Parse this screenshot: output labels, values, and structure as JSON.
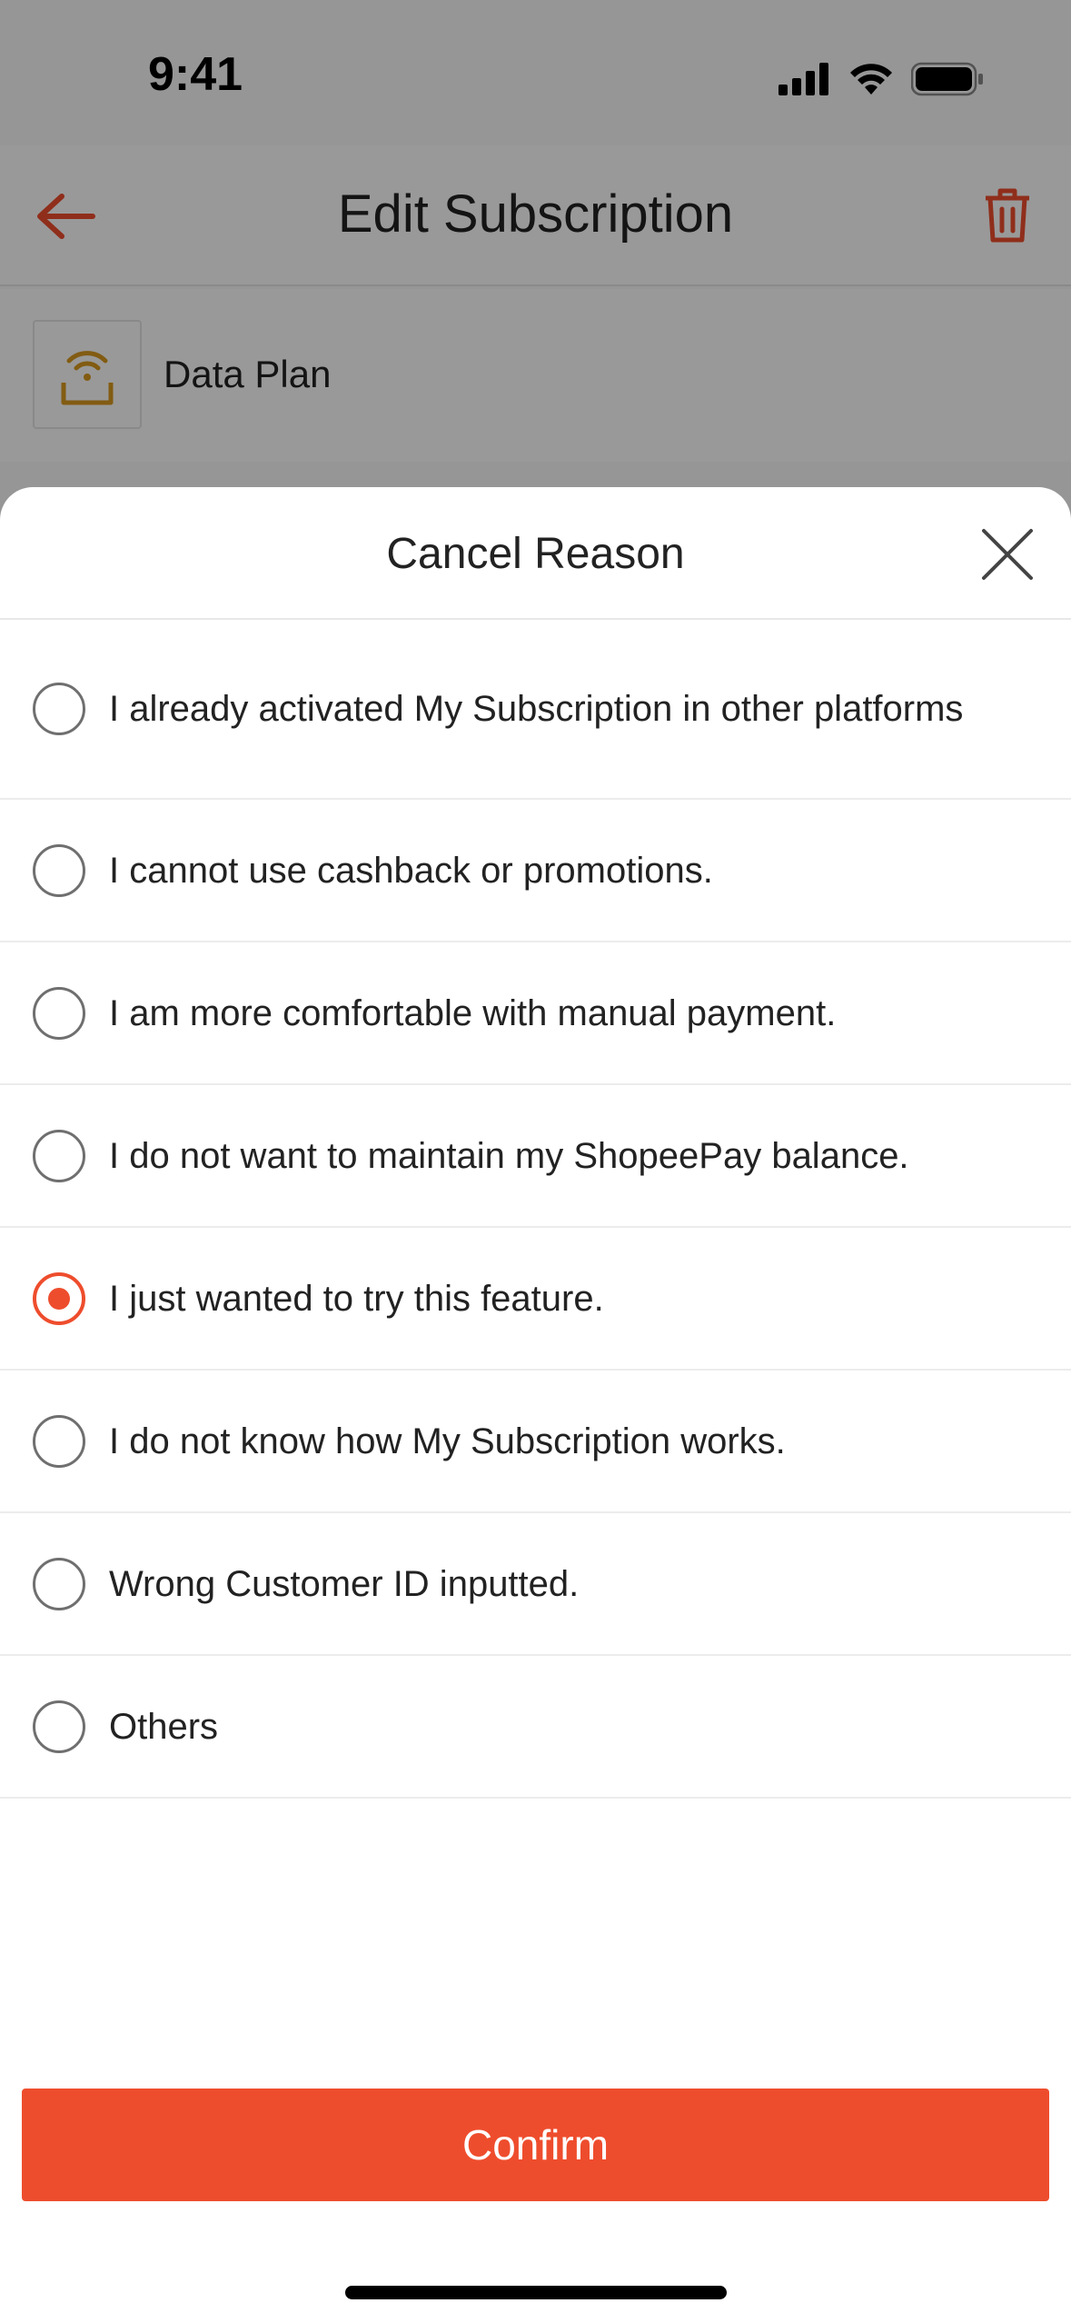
{
  "status_bar": {
    "time": "9:41"
  },
  "nav": {
    "title": "Edit Subscription"
  },
  "plan": {
    "label": "Data Plan"
  },
  "sheet": {
    "title": "Cancel Reason",
    "reasons": [
      {
        "label": "I already activated My Subscription in other platforms",
        "selected": false
      },
      {
        "label": "I cannot use cashback or promotions.",
        "selected": false
      },
      {
        "label": "I am more comfortable with manual payment.",
        "selected": false
      },
      {
        "label": "I do not want to maintain my ShopeePay balance.",
        "selected": false
      },
      {
        "label": "I just wanted to try this feature.",
        "selected": true
      },
      {
        "label": "I do not know how My Subscription works.",
        "selected": false
      },
      {
        "label": "Wrong Customer ID inputted.",
        "selected": false
      },
      {
        "label": "Others",
        "selected": false
      }
    ],
    "confirm_label": "Confirm"
  },
  "colors": {
    "accent": "#ee4d2d",
    "plan_icon": "#d99a1e",
    "overlay": "rgba(0,0,0,0.40)"
  },
  "icons": {
    "back": "back-arrow-icon",
    "delete": "trash-icon",
    "plan": "wifi-router-icon",
    "close": "close-icon",
    "signal": "cellular-signal-icon",
    "wifi": "wifi-icon",
    "battery": "battery-icon"
  }
}
